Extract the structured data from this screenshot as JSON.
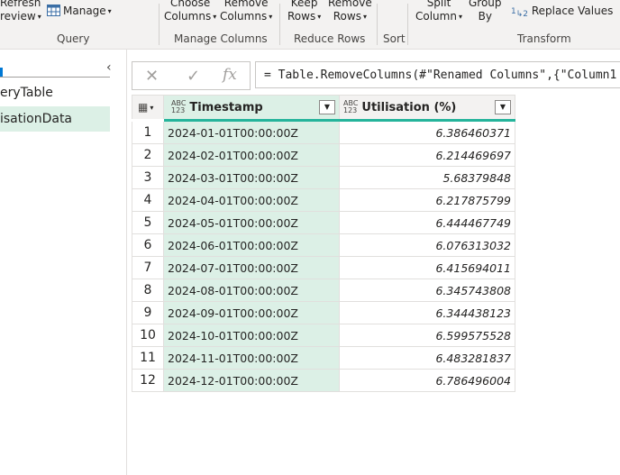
{
  "ribbon": {
    "refresh_line1": "Refresh",
    "refresh_line2": "review",
    "manage_label": "Manage",
    "choose_line1": "Choose",
    "choose_line2": "Columns",
    "remove_cols_line1": "Remove",
    "remove_cols_line2": "Columns",
    "keep_line1": "Keep",
    "keep_line2": "Rows",
    "remove_rows_line1": "Remove",
    "remove_rows_line2": "Rows",
    "split_line1": "Split",
    "split_line2": "Column",
    "group_line1": "Group",
    "group_line2": "By",
    "replace_values_label": "Replace Values",
    "groups": {
      "query": "Query",
      "manage_columns": "Manage Columns",
      "reduce_rows": "Reduce Rows",
      "sort": "Sort",
      "transform": "Transform"
    }
  },
  "queries_pane": {
    "items": [
      "eryTable",
      "isationData"
    ],
    "selected_index": 1
  },
  "formula_bar": {
    "cancel_icon": "✕",
    "commit_icon": "✓",
    "fx_label": "fx",
    "formula": "= Table.RemoveColumns(#\"Renamed Columns\",{\"Column1"
  },
  "table": {
    "type_badge_top": "ABC",
    "type_badge_bottom": "123",
    "columns": [
      "Timestamp",
      "Utilisation (%)"
    ],
    "rows": [
      {
        "n": "1",
        "ts": "2024-01-01T00:00:00Z",
        "val": "6.386460371"
      },
      {
        "n": "2",
        "ts": "2024-02-01T00:00:00Z",
        "val": "6.214469697"
      },
      {
        "n": "3",
        "ts": "2024-03-01T00:00:00Z",
        "val": "5.68379848"
      },
      {
        "n": "4",
        "ts": "2024-04-01T00:00:00Z",
        "val": "6.217875799"
      },
      {
        "n": "5",
        "ts": "2024-05-01T00:00:00Z",
        "val": "6.444467749"
      },
      {
        "n": "6",
        "ts": "2024-06-01T00:00:00Z",
        "val": "6.076313032"
      },
      {
        "n": "7",
        "ts": "2024-07-01T00:00:00Z",
        "val": "6.415694011"
      },
      {
        "n": "8",
        "ts": "2024-08-01T00:00:00Z",
        "val": "6.345743808"
      },
      {
        "n": "9",
        "ts": "2024-09-01T00:00:00Z",
        "val": "6.344438123"
      },
      {
        "n": "10",
        "ts": "2024-10-01T00:00:00Z",
        "val": "6.599575528"
      },
      {
        "n": "11",
        "ts": "2024-11-01T00:00:00Z",
        "val": "6.483281837"
      },
      {
        "n": "12",
        "ts": "2024-12-01T00:00:00Z",
        "val": "6.786496004"
      }
    ]
  },
  "colors": {
    "selected_column": "#dcf0e6",
    "column_quality_bar": "#25b49b",
    "accent": "#0078d4"
  }
}
